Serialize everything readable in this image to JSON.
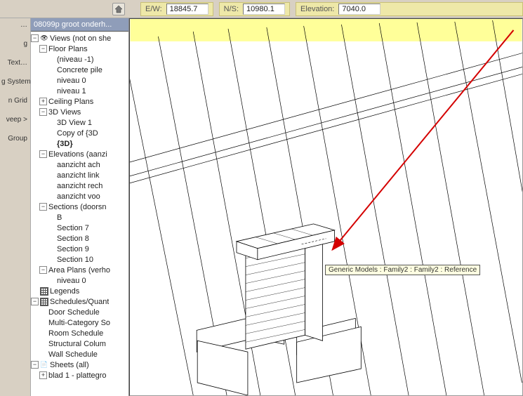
{
  "toolbar": {
    "ew_label": "E/W:",
    "ew_value": "18845.7",
    "ns_label": "N/S:",
    "ns_value": "10980.1",
    "elev_label": "Elevation:",
    "elev_value": "7040.0"
  },
  "panel": {
    "title": "08099p groot onderh..."
  },
  "tree": [
    {
      "depth": 0,
      "exp": "-",
      "icon": "eye",
      "label": "Views (not on she"
    },
    {
      "depth": 1,
      "exp": "-",
      "label": "Floor Plans"
    },
    {
      "depth": 2,
      "exp": "",
      "label": "(niveau -1)"
    },
    {
      "depth": 2,
      "exp": "",
      "label": "Concrete pile"
    },
    {
      "depth": 2,
      "exp": "",
      "label": "niveau 0"
    },
    {
      "depth": 2,
      "exp": "",
      "label": "niveau 1"
    },
    {
      "depth": 1,
      "exp": "+",
      "label": "Ceiling Plans"
    },
    {
      "depth": 1,
      "exp": "-",
      "label": "3D Views"
    },
    {
      "depth": 2,
      "exp": "",
      "label": "3D View 1"
    },
    {
      "depth": 2,
      "exp": "",
      "label": "Copy of {3D"
    },
    {
      "depth": 2,
      "exp": "",
      "label": "{3D}",
      "bold": true
    },
    {
      "depth": 1,
      "exp": "-",
      "label": "Elevations (aanzi"
    },
    {
      "depth": 2,
      "exp": "",
      "label": "aanzicht ach"
    },
    {
      "depth": 2,
      "exp": "",
      "label": "aanzicht link"
    },
    {
      "depth": 2,
      "exp": "",
      "label": "aanzicht rech"
    },
    {
      "depth": 2,
      "exp": "",
      "label": "aanzicht voo"
    },
    {
      "depth": 1,
      "exp": "-",
      "label": "Sections (doorsn"
    },
    {
      "depth": 2,
      "exp": "",
      "label": "B"
    },
    {
      "depth": 2,
      "exp": "",
      "label": "Section 7"
    },
    {
      "depth": 2,
      "exp": "",
      "label": "Section 8"
    },
    {
      "depth": 2,
      "exp": "",
      "label": "Section 9"
    },
    {
      "depth": 2,
      "exp": "",
      "label": "Section 10"
    },
    {
      "depth": 1,
      "exp": "-",
      "label": "Area Plans (verho"
    },
    {
      "depth": 2,
      "exp": "",
      "label": "niveau 0"
    },
    {
      "depth": 0,
      "exp": "",
      "icon": "grid",
      "label": "Legends"
    },
    {
      "depth": 0,
      "exp": "-",
      "icon": "grid",
      "label": "Schedules/Quant"
    },
    {
      "depth": 1,
      "exp": "",
      "label": "Door Schedule"
    },
    {
      "depth": 1,
      "exp": "",
      "label": "Multi-Category So"
    },
    {
      "depth": 1,
      "exp": "",
      "label": "Room Schedule"
    },
    {
      "depth": 1,
      "exp": "",
      "label": "Structural Colum"
    },
    {
      "depth": 1,
      "exp": "",
      "label": "Wall Schedule"
    },
    {
      "depth": 0,
      "exp": "-",
      "icon": "sheet",
      "label": "Sheets (all)"
    },
    {
      "depth": 1,
      "exp": "+",
      "label": "blad 1 - plattegro"
    }
  ],
  "sidebar_buttons": [
    "",
    "",
    "g",
    "",
    "",
    "",
    "Text…",
    "g System",
    "n Grid",
    "",
    "veep >",
    "",
    "",
    "",
    "Group",
    ""
  ],
  "tooltip": "Generic Models : Family2 : Family2 : Reference"
}
